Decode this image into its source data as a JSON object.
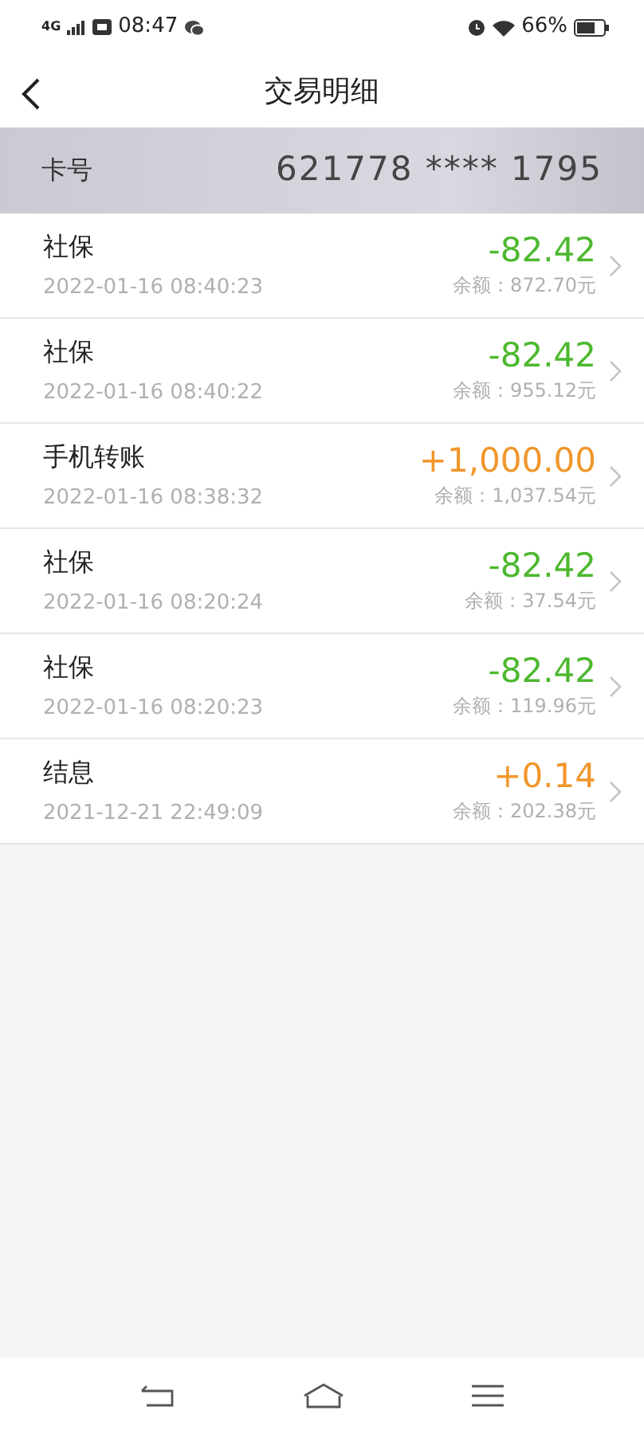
{
  "status_bar": {
    "network": "4G",
    "time": "08:47",
    "battery": "66%"
  },
  "header": {
    "title": "交易明细"
  },
  "card": {
    "label": "卡号",
    "number": "621778 **** 1795"
  },
  "transactions": [
    {
      "name": "社保",
      "time": "2022-01-16 08:40:23",
      "amount": "-82.42",
      "kind": "debit",
      "balance": "余额：872.70元"
    },
    {
      "name": "社保",
      "time": "2022-01-16 08:40:22",
      "amount": "-82.42",
      "kind": "debit",
      "balance": "余额：955.12元"
    },
    {
      "name": "手机转账",
      "time": "2022-01-16 08:38:32",
      "amount": "+1,000.00",
      "kind": "credit",
      "balance": "余额：1,037.54元"
    },
    {
      "name": "社保",
      "time": "2022-01-16 08:20:24",
      "amount": "-82.42",
      "kind": "debit",
      "balance": "余额：37.54元"
    },
    {
      "name": "社保",
      "time": "2022-01-16 08:20:23",
      "amount": "-82.42",
      "kind": "debit",
      "balance": "余额：119.96元"
    },
    {
      "name": "结息",
      "time": "2021-12-21 22:49:09",
      "amount": "+0.14",
      "kind": "credit",
      "balance": "余额：202.38元"
    }
  ]
}
